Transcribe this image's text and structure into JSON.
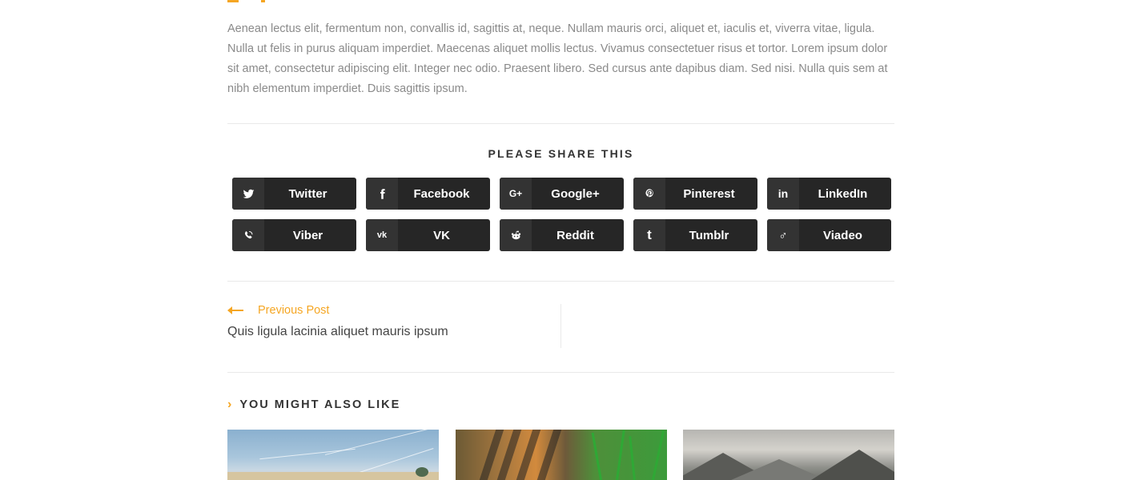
{
  "article": {
    "paragraph": "Aenean lectus elit, fermentum non, convallis id, sagittis at, neque. Nullam mauris orci, aliquet et, iaculis et, viverra vitae, ligula. Nulla ut felis in purus aliquam imperdiet. Maecenas aliquet mollis lectus. Vivamus consectetuer risus et tortor. Lorem ipsum dolor sit amet, consectetur adipiscing elit. Integer nec odio. Praesent libero. Sed cursus ante dapibus diam. Sed nisi. Nulla quis sem at nibh elementum imperdiet. Duis sagittis ipsum."
  },
  "share": {
    "title": "PLEASE SHARE THIS",
    "buttons": [
      {
        "label": "Twitter",
        "icon": "twitter-icon"
      },
      {
        "label": "Facebook",
        "icon": "facebook-icon"
      },
      {
        "label": "Google+",
        "icon": "google-plus-icon"
      },
      {
        "label": "Pinterest",
        "icon": "pinterest-icon"
      },
      {
        "label": "LinkedIn",
        "icon": "linkedin-icon"
      },
      {
        "label": "Viber",
        "icon": "viber-icon"
      },
      {
        "label": "VK",
        "icon": "vk-icon"
      },
      {
        "label": "Reddit",
        "icon": "reddit-icon"
      },
      {
        "label": "Tumblr",
        "icon": "tumblr-icon"
      },
      {
        "label": "Viadeo",
        "icon": "viadeo-icon"
      }
    ]
  },
  "post_nav": {
    "prev_label": "Previous Post",
    "prev_title": "Quis ligula lacinia aliquet mauris ipsum"
  },
  "related": {
    "title": "YOU MIGHT ALSO LIKE"
  },
  "colors": {
    "accent": "#f5a623",
    "button_bg": "#262626",
    "text_muted": "#8a8a8a"
  }
}
